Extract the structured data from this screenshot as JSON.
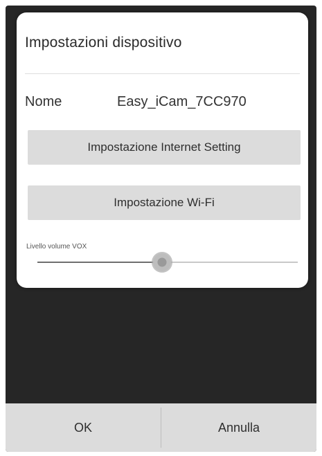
{
  "dialog": {
    "title": "Impostazioni dispositivo",
    "name_label": "Nome",
    "name_value": "Easy_iCam_7CC970",
    "internet_button_label": "Impostazione Internet Setting",
    "wifi_button_label": "Impostazione Wi-Fi",
    "vox_slider": {
      "label": "Livello volume VOX",
      "value_percent": 48
    }
  },
  "actions": {
    "ok_label": "OK",
    "cancel_label": "Annulla"
  },
  "colors": {
    "background": "#262626",
    "dialog": "#ffffff",
    "button": "#dcdcdc",
    "text": "#2e2e2e"
  }
}
